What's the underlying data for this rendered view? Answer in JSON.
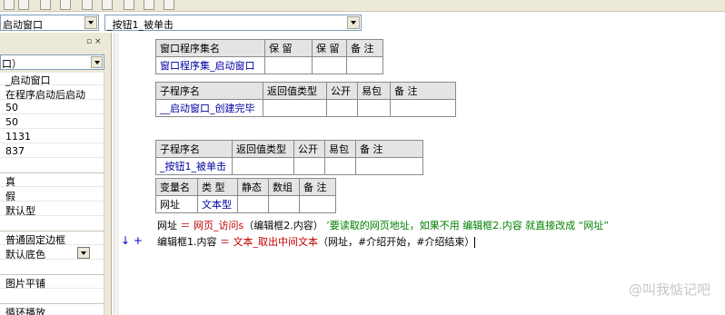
{
  "toolbar": {
    "icons": [
      "align-left-icon",
      "align-center-icon",
      "align-right-icon",
      "align-top-icon",
      "align-middle-icon",
      "align-bottom-icon",
      "same-width-icon",
      "same-height-icon",
      "same-size-icon"
    ]
  },
  "object_combo": {
    "value": "启动窗口"
  },
  "method_combo": {
    "value": "_按钮1_被单击"
  },
  "left_panel": {
    "controls": "▫ × ",
    "type_combo": "口）",
    "props": [
      "_启动窗口",
      "在程序启动后启动",
      "50",
      "50",
      "1131",
      "837",
      "",
      "真",
      "假",
      "默认型",
      "",
      "普通固定边框",
      "默认底色",
      "",
      "图片平铺",
      "",
      "循环播放"
    ]
  },
  "code": {
    "assembly_table": {
      "headers": [
        "窗口程序集名",
        "保 留",
        "保 留",
        "备 注"
      ],
      "row": [
        "窗口程序集_启动窗口",
        "",
        "",
        ""
      ]
    },
    "sub1_table": {
      "headers": [
        "子程序名",
        "返回值类型",
        "公开",
        "易包",
        "备 注"
      ],
      "row": [
        "__启动窗口_创建完毕",
        "",
        "",
        "",
        ""
      ]
    },
    "sub2_table": {
      "headers": [
        "子程序名",
        "返回值类型",
        "公开",
        "易包",
        "备 注"
      ],
      "row": [
        "_按钮1_被单击",
        "",
        "",
        "",
        ""
      ]
    },
    "var_table": {
      "headers": [
        "变量名",
        "类 型",
        "静态",
        "数组",
        "备 注"
      ],
      "row": [
        "网址",
        "文本型",
        "",
        "",
        ""
      ]
    },
    "line1": {
      "a": "网址",
      "b": " ＝ ",
      "c": "网页_访问s",
      "d": "（编辑框2.内容）",
      "e": "  ’要读取的网页地址，如果不用 编辑框2.内容   就直接改成 “网址”"
    },
    "line2": {
      "a": "编辑框1.内容",
      "b": " ＝ ",
      "c": "文本_取出中间文本",
      "d": "（网址，#介绍开始，#介绍结束）"
    },
    "gutter": "↓ +"
  },
  "watermark": "@叫我惦记吧"
}
